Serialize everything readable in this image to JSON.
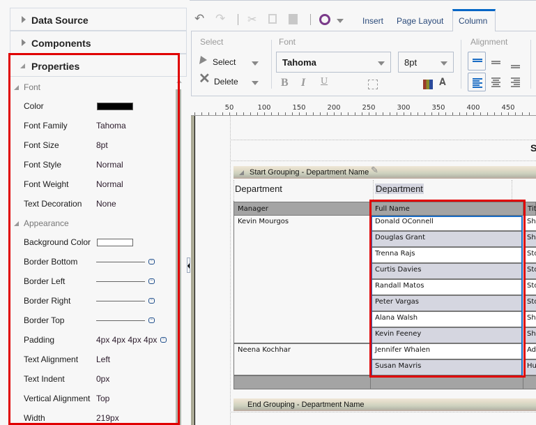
{
  "left_panel": {
    "sections": [
      {
        "label": "Data Source",
        "expanded": false
      },
      {
        "label": "Components",
        "expanded": false
      },
      {
        "label": "Properties",
        "expanded": true
      }
    ],
    "properties": {
      "font_group": "Font",
      "font": [
        {
          "label": "Color",
          "type": "color",
          "value": "#000000"
        },
        {
          "label": "Font Family",
          "value": "Tahoma"
        },
        {
          "label": "Font Size",
          "value": "8pt"
        },
        {
          "label": "Font Style",
          "value": "Normal"
        },
        {
          "label": "Font Weight",
          "value": "Normal"
        },
        {
          "label": "Text Decoration",
          "value": "None"
        }
      ],
      "appearance_group": "Appearance",
      "appearance": [
        {
          "label": "Background Color",
          "type": "color",
          "value": "#ffffff"
        },
        {
          "label": "Border Bottom",
          "type": "border"
        },
        {
          "label": "Border Left",
          "type": "border"
        },
        {
          "label": "Border Right",
          "type": "border"
        },
        {
          "label": "Border Top",
          "type": "border"
        },
        {
          "label": "Padding",
          "value": "4px 4px 4px 4px"
        },
        {
          "label": "Text Alignment",
          "value": "Left"
        },
        {
          "label": "Text Indent",
          "value": "0px"
        },
        {
          "label": "Vertical Alignment",
          "value": "Top"
        },
        {
          "label": "Width",
          "value": "219px"
        }
      ]
    }
  },
  "toolbar": {
    "icons": [
      "undo-icon",
      "redo-icon",
      "cut-icon",
      "copy-icon",
      "paste-icon",
      "preview-icon"
    ],
    "tabs": [
      {
        "label": "Insert",
        "active": false
      },
      {
        "label": "Page Layout",
        "active": false
      },
      {
        "label": "Column",
        "active": true
      }
    ],
    "select_group": {
      "title": "Select",
      "select_label": "Select",
      "delete_label": "Delete"
    },
    "font_group": {
      "title": "Font",
      "font_family": "Tahoma",
      "font_size": "8pt",
      "bold": "B",
      "italic": "I",
      "underline": "U"
    },
    "alignment_group": {
      "title": "Alignment"
    }
  },
  "ruler": {
    "ticks": [
      "50",
      "100",
      "150",
      "200",
      "250",
      "300",
      "350",
      "400",
      "450"
    ]
  },
  "canvas": {
    "title_partial": "S",
    "start_group": "Start Grouping - Department Name",
    "end_group": "End Grouping - Department Name",
    "dept_label": "Department",
    "dept_value": "Department",
    "columns": [
      "Manager",
      "Full Name",
      "Titl"
    ],
    "rows": [
      {
        "manager": "Kevin Mourgos",
        "full_name": "Donald OConnell",
        "title": "Shi"
      },
      {
        "manager": "",
        "full_name": "Douglas Grant",
        "title": "Shi"
      },
      {
        "manager": "",
        "full_name": "Trenna Rajs",
        "title": "Sto"
      },
      {
        "manager": "",
        "full_name": "Curtis Davies",
        "title": "Sto"
      },
      {
        "manager": "",
        "full_name": "Randall Matos",
        "title": "Sto"
      },
      {
        "manager": "",
        "full_name": "Peter Vargas",
        "title": "Sto"
      },
      {
        "manager": "",
        "full_name": "Alana Walsh",
        "title": "Shi"
      },
      {
        "manager": "",
        "full_name": "Kevin Feeney",
        "title": "Shi"
      },
      {
        "manager": "Neena Kochhar",
        "full_name": "Jennifer Whalen",
        "title": "Adi"
      },
      {
        "manager": "",
        "full_name": "Susan Mavris",
        "title": "Hu"
      }
    ]
  },
  "colors": {
    "highlight": "#e00000",
    "accent": "#0066cc",
    "row_alt": "#d5d6e0",
    "header": "#a4a4a4"
  }
}
